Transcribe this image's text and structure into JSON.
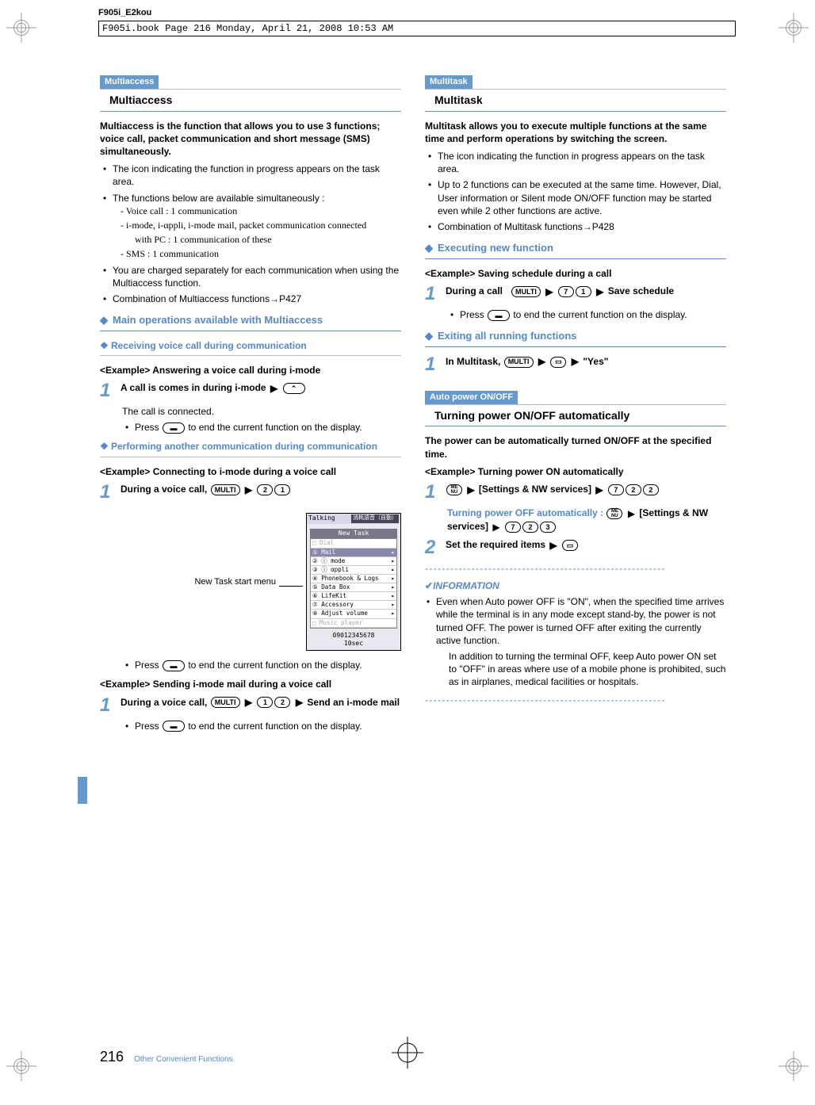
{
  "header": {
    "model": "F905i_E2kou",
    "book_info": "F905i.book  Page 216  Monday, April 21, 2008  10:53 AM"
  },
  "left": {
    "tag": "Multiaccess",
    "title": "Multiaccess",
    "intro": "Multiaccess is the function that allows you to use 3 functions; voice call, packet communication and short message (SMS) simultaneously.",
    "b1": "The icon indicating the function in progress appears on the task area.",
    "b2": "The functions below are available simultaneously :",
    "s1": "- Voice call : 1 communication",
    "s2": "- i-mode, i-αppli, i-mode mail, packet communication connected",
    "s2b": "with PC : 1 communication of these",
    "s3": "- SMS : 1 communication",
    "b3": "You are charged separately for each communication when using the Multiaccess function.",
    "b4": "Combination of Multiaccess functions→P427",
    "dh1": "Main operations available with Multiaccess",
    "sh1": "Receiving voice call during communication",
    "ex1": "<Example>    Answering a voice call during i-mode",
    "step1": "A call is comes in during i-mode",
    "step1_cont1": "The call is connected.",
    "step1_cont2": "Press           to end the current function on the display.",
    "sh2": "Performing another communication during communication",
    "ex2": "<Example>    Connecting to i-mode during a voice call",
    "step2": "During a voice call,",
    "screenshot_label": "New Task start menu",
    "phone": {
      "title": "Talking",
      "badge": "消耗語音（自動）",
      "menu_title": "New Task",
      "m0": "□ Dial",
      "m1": "① Mail",
      "m2": "② ⓘ mode",
      "m3": "③ ⓘ αppli",
      "m4": "④ Phonebook & Logs",
      "m5": "⑤ Data Box",
      "m6": "⑥ LifeKit",
      "m7": "⑦ Accessory",
      "m8": "⑧ Adjust volume",
      "m9": "□ Music player",
      "bottom1": "09012345678",
      "bottom2": "10sec"
    },
    "press_end": "Press           to end the current function on the display.",
    "ex3": "<Example>    Sending i-mode mail during a voice call",
    "step3": "During a voice call,",
    "step3_tail": "Send an i-mode mail",
    "step3_cont": "Press           to end the current function on the display."
  },
  "right": {
    "tag": "Multitask",
    "title": "Multitask",
    "intro": "Multitask allows you to execute multiple functions at the same time and perform operations by switching the screen.",
    "b1": "The icon indicating the function in progress appears on the task area.",
    "b2": "Up to 2 functions can be executed at the same time. However, Dial, User information or Silent mode ON/OFF function may be started even while 2 other functions are active.",
    "b3": "Combination of Multitask functions→P428",
    "dh1": "Executing new function",
    "ex1": "<Example>    Saving schedule during a call",
    "step1a": "During a call",
    "step1b": "Save schedule",
    "step1_cont": "Press           to end the current function on the display.",
    "dh2": "Exiting all running functions",
    "step2": "In Multitask,",
    "step2_tail": "\"Yes\"",
    "tag2": "Auto power ON/OFF",
    "title2": "Turning power ON/OFF automatically",
    "intro2": "The power can be automatically turned ON/OFF at the specified time.",
    "ex2": "<Example>    Turning power ON automatically",
    "step_r1": "[Settings & NW services]",
    "step_r1_sub": "Turning power OFF automatically :",
    "step_r1_sub2": "[Settings & NW services]",
    "step_r2": "Set the required items",
    "info_title": "INFORMATION",
    "info_b1": "Even when Auto power OFF is \"ON\", when the specified time arrives while the terminal is in any mode except stand-by, the power is not turned OFF. The power is turned OFF after exiting the currently active function.",
    "info_b1_inner": "In addition to turning the terminal OFF, keep Auto power ON set to \"OFF\" in areas where use of a mobile phone is prohibited, such as in airplanes, medical facilities or hospitals."
  },
  "footer": {
    "page": "216",
    "category": "Other Convenient Functions"
  },
  "keys": {
    "multi": "MULTI",
    "menu_nu": "ME NU",
    "k1": "1",
    "k2": "2",
    "k3": "3",
    "k7": "7",
    "phone": "☎",
    "camera": "📷",
    "book": "⬚"
  }
}
